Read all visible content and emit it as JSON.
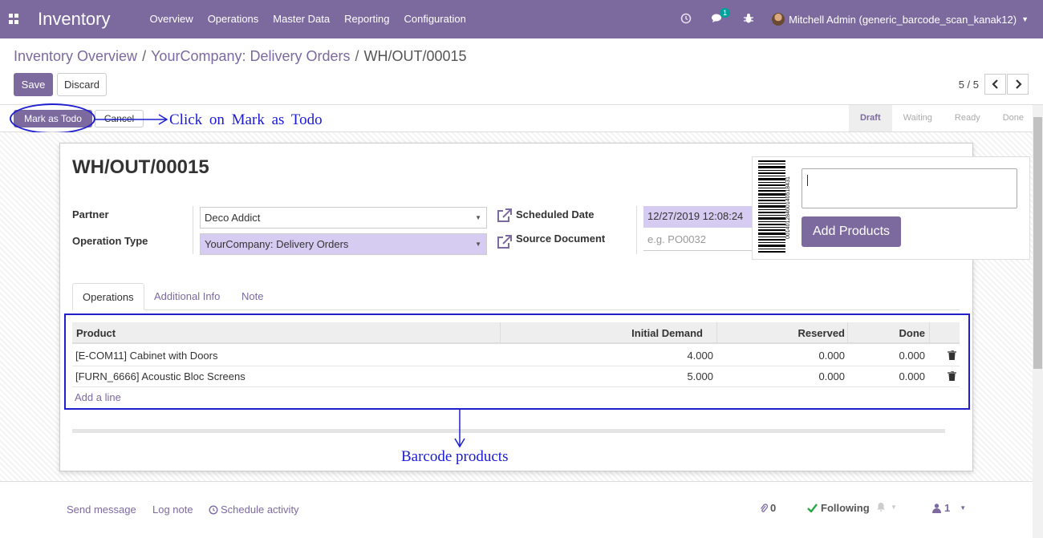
{
  "navbar": {
    "brand": "Inventory",
    "menu": [
      "Overview",
      "Operations",
      "Master Data",
      "Reporting",
      "Configuration"
    ],
    "chat_badge": "1",
    "user": "Mitchell Admin (generic_barcode_scan_kanak12)"
  },
  "breadcrumb": {
    "items": [
      "Inventory Overview",
      "YourCompany: Delivery Orders"
    ],
    "current": "WH/OUT/00015",
    "separator": "/"
  },
  "actions": {
    "save": "Save",
    "discard": "Discard"
  },
  "pager": {
    "text": "5 / 5",
    "prev": "‹",
    "next": "›"
  },
  "statusbar": {
    "mark_todo": "Mark as Todo",
    "cancel": "Cancel",
    "stages": [
      "Draft",
      "Waiting",
      "Ready",
      "Done"
    ]
  },
  "annotations": {
    "todo_note": "Click on Mark as Todo",
    "barcode_note": "Barcode products"
  },
  "form": {
    "title": "WH/OUT/00015",
    "partner_label": "Partner",
    "partner_value": "Deco Addict",
    "operation_type_label": "Operation Type",
    "operation_type_value": "YourCompany: Delivery Orders",
    "scheduled_date_label": "Scheduled Date",
    "scheduled_date_value": "12/27/2019 12:08:24",
    "source_document_label": "Source Document",
    "source_document_placeholder": "e.g. PO0032"
  },
  "barcode": {
    "digits": "00140128460140518431",
    "add_products": "Add Products"
  },
  "tabs": [
    "Operations",
    "Additional Info",
    "Note"
  ],
  "table": {
    "headers": [
      "Product",
      "Initial Demand",
      "Reserved",
      "Done"
    ],
    "rows": [
      {
        "product": "[E-COM11] Cabinet with Doors",
        "initial_demand": "4.000",
        "reserved": "0.000",
        "done": "0.000"
      },
      {
        "product": "[FURN_6666] Acoustic Bloc Screens",
        "initial_demand": "5.000",
        "reserved": "0.000",
        "done": "0.000"
      }
    ],
    "add_line": "Add a line"
  },
  "chatter": {
    "send_message": "Send message",
    "log_note": "Log note",
    "schedule_activity": "Schedule activity",
    "attachments": "0",
    "following": "Following",
    "followers": "1"
  },
  "colors": {
    "primary": "#7C6A9F",
    "annotation": "#1f1fd0",
    "required_field": "#d6ccf2"
  }
}
